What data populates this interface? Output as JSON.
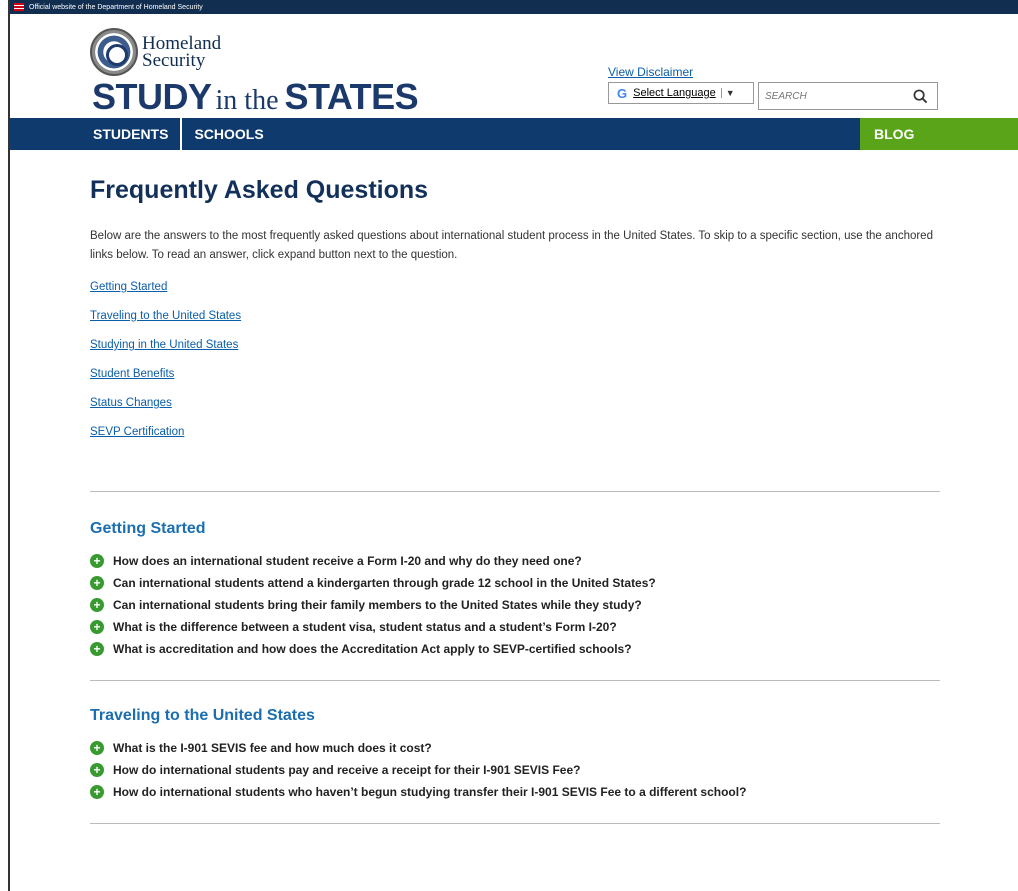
{
  "gov_banner": {
    "text": "Official website of the Department of Homeland Security"
  },
  "logo": {
    "line1": "Homeland",
    "line2": "Security"
  },
  "site_title": {
    "part1": "STUDY",
    "part2": "in the",
    "part3": "STATES"
  },
  "header": {
    "disclaimer_link": "View Disclaimer",
    "language_select_label": "Select Language",
    "search_placeholder": "SEARCH"
  },
  "nav": {
    "items": [
      "STUDENTS",
      "SCHOOLS"
    ],
    "blog": "BLOG"
  },
  "colors": {
    "nav_bg": "#0f3a6d",
    "blog_bg": "#5aa419",
    "link": "#0b5ea8",
    "section_title": "#1b6fb0",
    "expand_icon": "#3a9a32"
  },
  "main": {
    "title": "Frequently Asked Questions",
    "intro": "Below are the answers to the most frequently asked questions about international student process in the United States. To skip to a specific section, use the anchored links below. To read an answer, click expand button next to the question.",
    "anchor_links": [
      "Getting Started",
      "Traveling to the United States",
      "Studying in the United States",
      "Student Benefits",
      "Status Changes",
      "SEVP Certification"
    ],
    "sections": [
      {
        "title": "Getting Started",
        "questions": [
          "How does an international student receive a Form I-20 and why do they need one?",
          "Can international students attend a kindergarten through grade 12 school in the United States?",
          "Can international students bring their family members to the United States while they study?",
          "What is the difference between a student visa, student status and a student’s Form I-20?",
          "What is accreditation and how does the Accreditation Act apply to SEVP-certified schools?"
        ]
      },
      {
        "title": "Traveling to the United States",
        "questions": [
          "What is the I-901 SEVIS fee and how much does it cost?",
          "How do international students pay and receive a receipt for their I-901 SEVIS Fee?",
          "How do international students who haven’t begun studying transfer their I-901 SEVIS Fee to a different school?"
        ]
      }
    ]
  }
}
